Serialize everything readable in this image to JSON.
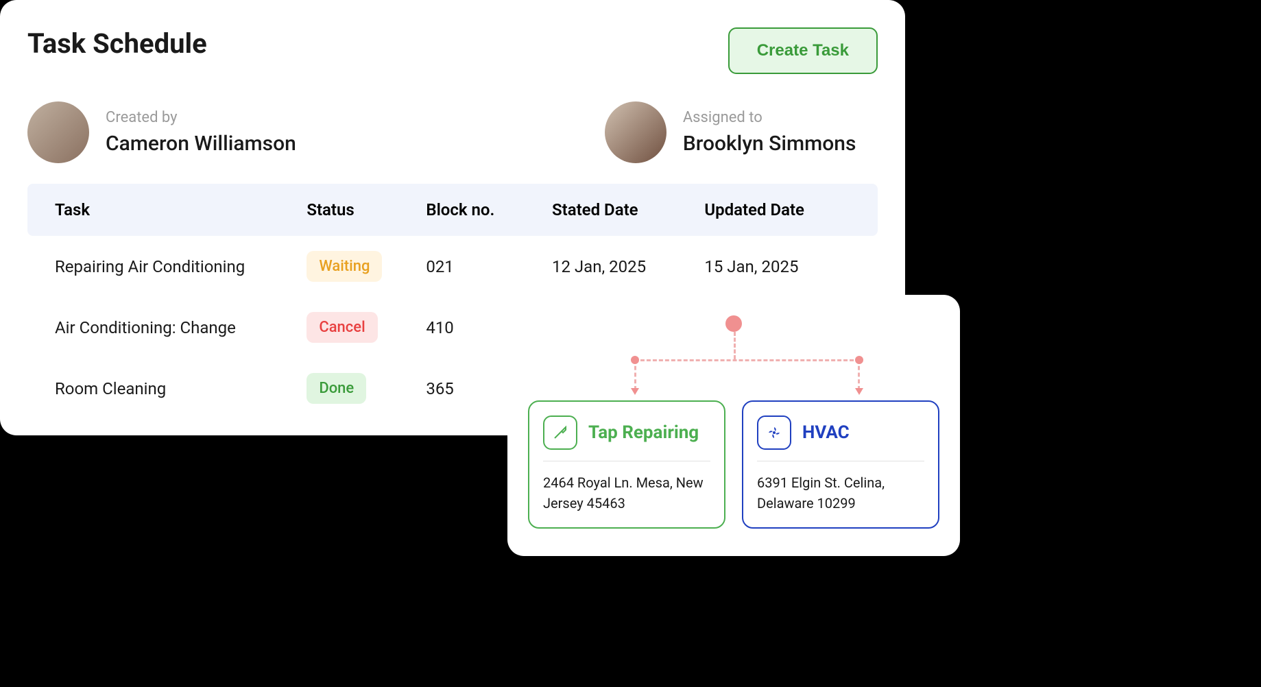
{
  "header": {
    "title": "Task Schedule",
    "create_button": "Create Task"
  },
  "people": {
    "created_by_label": "Created by",
    "created_by_name": "Cameron Williamson",
    "assigned_to_label": "Assigned to",
    "assigned_to_name": "Brooklyn Simmons"
  },
  "table": {
    "headers": {
      "task": "Task",
      "status": "Status",
      "block": "Block no.",
      "stated": "Stated Date",
      "updated": "Updated Date"
    },
    "rows": [
      {
        "task": "Repairing Air Conditioning",
        "status": "Waiting",
        "status_class": "waiting",
        "block": "021",
        "stated": "12 Jan, 2025",
        "updated": "15 Jan, 2025"
      },
      {
        "task": "Air Conditioning: Change",
        "status": "Cancel",
        "status_class": "cancel",
        "block": "410",
        "stated": "",
        "updated": ""
      },
      {
        "task": "Room Cleaning",
        "status": "Done",
        "status_class": "done",
        "block": "365",
        "stated": "",
        "updated": ""
      }
    ]
  },
  "services": [
    {
      "title": "Tap Repairing",
      "address": "2464 Royal Ln. Mesa, New Jersey 45463",
      "icon": "screwdriver-icon"
    },
    {
      "title": "HVAC",
      "address": "6391 Elgin St. Celina, Delaware 10299",
      "icon": "fan-icon"
    }
  ]
}
